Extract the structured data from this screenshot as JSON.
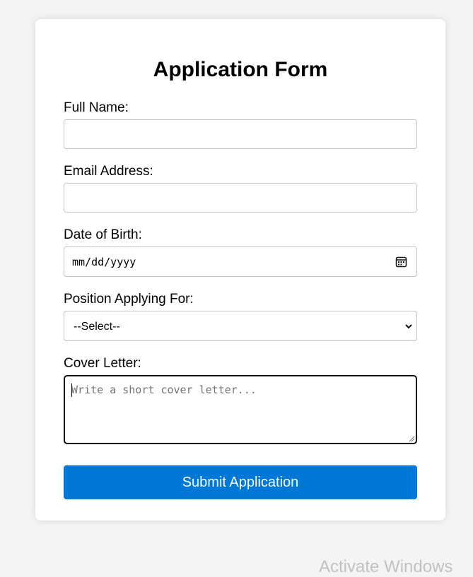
{
  "form": {
    "title": "Application Form",
    "full_name_label": "Full Name:",
    "full_name_value": "",
    "email_label": "Email Address:",
    "email_value": "",
    "dob_label": "Date of Birth:",
    "dob_placeholder": "mm/dd/yyyy",
    "position_label": "Position Applying For:",
    "position_selected": "--Select--",
    "cover_letter_label": "Cover Letter:",
    "cover_letter_placeholder": "Write a short cover letter...",
    "submit_label": "Submit Application"
  },
  "icons": {
    "date": "calendar-icon",
    "select": "chevron-down-icon",
    "textarea": "resize-handle-icon"
  },
  "colors": {
    "background": "#f4f4f4",
    "card": "#ffffff",
    "accent": "#0078d7",
    "field_border": "#c4c4c4",
    "focused_border": "#111111"
  },
  "watermark": "Activate Windows"
}
